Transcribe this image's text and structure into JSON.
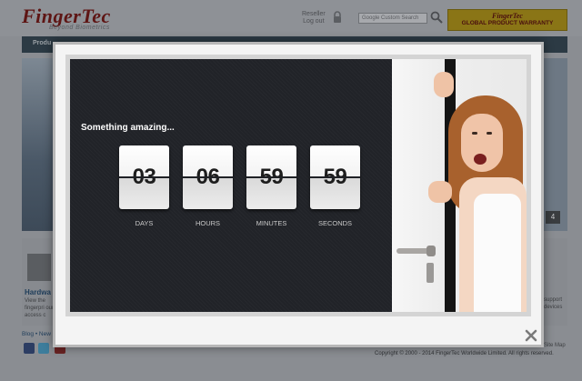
{
  "site": {
    "logo": "FingerTec",
    "logo_tagline": "Beyond Biometrics",
    "reseller_line1": "Reseller",
    "reseller_line2": "Log out",
    "search_placeholder": "Google Custom Search",
    "warranty_brand": "FingerTec",
    "warranty_text": "GLOBAL PRODUCT WARRANTY",
    "nav_first": "Produ",
    "hero_page_number": "4",
    "hardware_title": "Hardwa",
    "hardware_text": "View the fingerpri our access c",
    "support_text": "support devices",
    "blog_links": "Blog • New",
    "footer_sitemap": "Site Map",
    "copyright": "Copyright © 2000 - 2014 FingerTec Worldwide Limited. All rights reserved."
  },
  "modal": {
    "headline": "Something amazing...",
    "countdown": [
      {
        "value": "03",
        "label": "DAYS"
      },
      {
        "value": "06",
        "label": "HOURS"
      },
      {
        "value": "59",
        "label": "MINUTES"
      },
      {
        "value": "59",
        "label": "SECONDS"
      }
    ]
  },
  "colors": {
    "dark_panel": "#212328",
    "tile_text": "#1d1d1d",
    "overlay": "#8a8d92"
  },
  "icons": [
    "lock-icon",
    "search-icon",
    "close-icon",
    "facebook-icon",
    "twitter-icon",
    "youtube-icon"
  ]
}
